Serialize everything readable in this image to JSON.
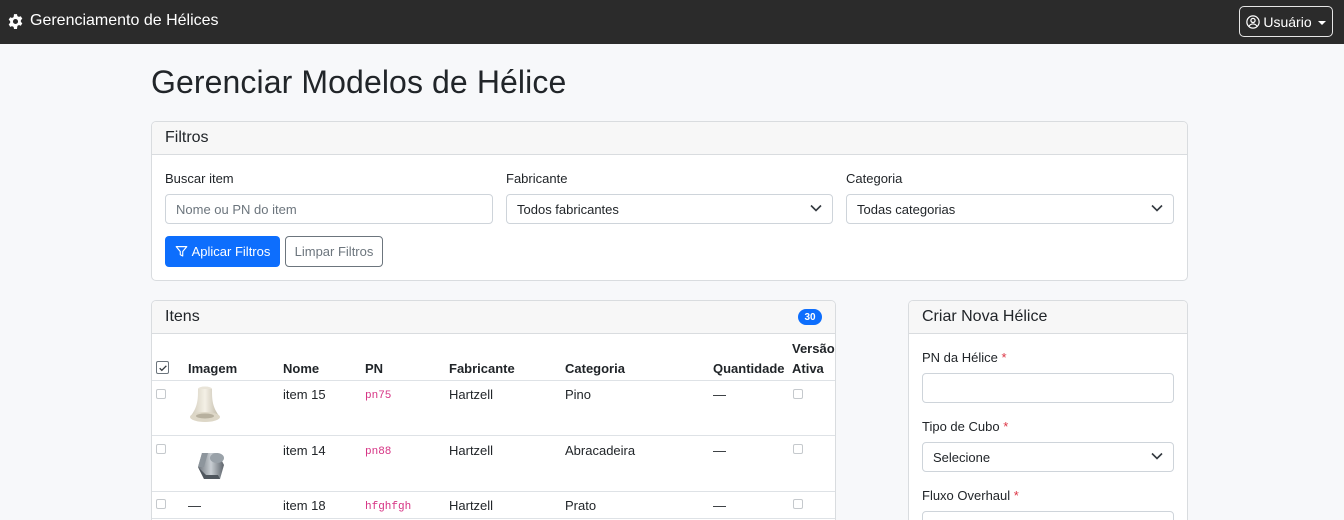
{
  "navbar": {
    "brand": "Gerenciamento de Hélices",
    "brand_icon": "gear-icon",
    "user_label": "Usuário",
    "user_icon": "user-circle-icon"
  },
  "page": {
    "title": "Gerenciar Modelos de Hélice"
  },
  "filters": {
    "header": "Filtros",
    "search_label": "Buscar item",
    "search_placeholder": "Nome ou PN do item",
    "manufacturer_label": "Fabricante",
    "manufacturer_value": "Todos fabricantes",
    "category_label": "Categoria",
    "category_value": "Todas categorias",
    "apply_label": "Aplicar Filtros",
    "clear_label": "Limpar Filtros"
  },
  "items": {
    "header": "Itens",
    "count": "30",
    "columns": {
      "image": "Imagem",
      "name": "Nome",
      "pn": "PN",
      "manufacturer": "Fabricante",
      "category": "Categoria",
      "quantity": "Quantidade",
      "active_version_1": "Versão",
      "active_version_2": "Ativa"
    },
    "rows": [
      {
        "image": "bushing-image",
        "name": "item 15",
        "pn": "pn75",
        "manufacturer": "Hartzell",
        "category": "Pino",
        "quantity": "—"
      },
      {
        "image": "bolt-image",
        "name": "item 14",
        "pn": "pn88",
        "manufacturer": "Hartzell",
        "category": "Abracadeira",
        "quantity": "—"
      },
      {
        "image": "—",
        "name": "item 18",
        "pn": "hfghfgh",
        "manufacturer": "Hartzell",
        "category": "Prato",
        "quantity": "—"
      }
    ]
  },
  "create": {
    "header": "Criar Nova Hélice",
    "pn_label": "PN da Hélice",
    "hub_label": "Tipo de Cubo",
    "hub_value": "Selecione",
    "overhaul_label": "Fluxo Overhaul",
    "required_mark": "*"
  },
  "colors": {
    "navbar": "#2b2b2b",
    "primary": "#0d6efd",
    "pn_text": "#d63384",
    "required": "#dc3545"
  }
}
